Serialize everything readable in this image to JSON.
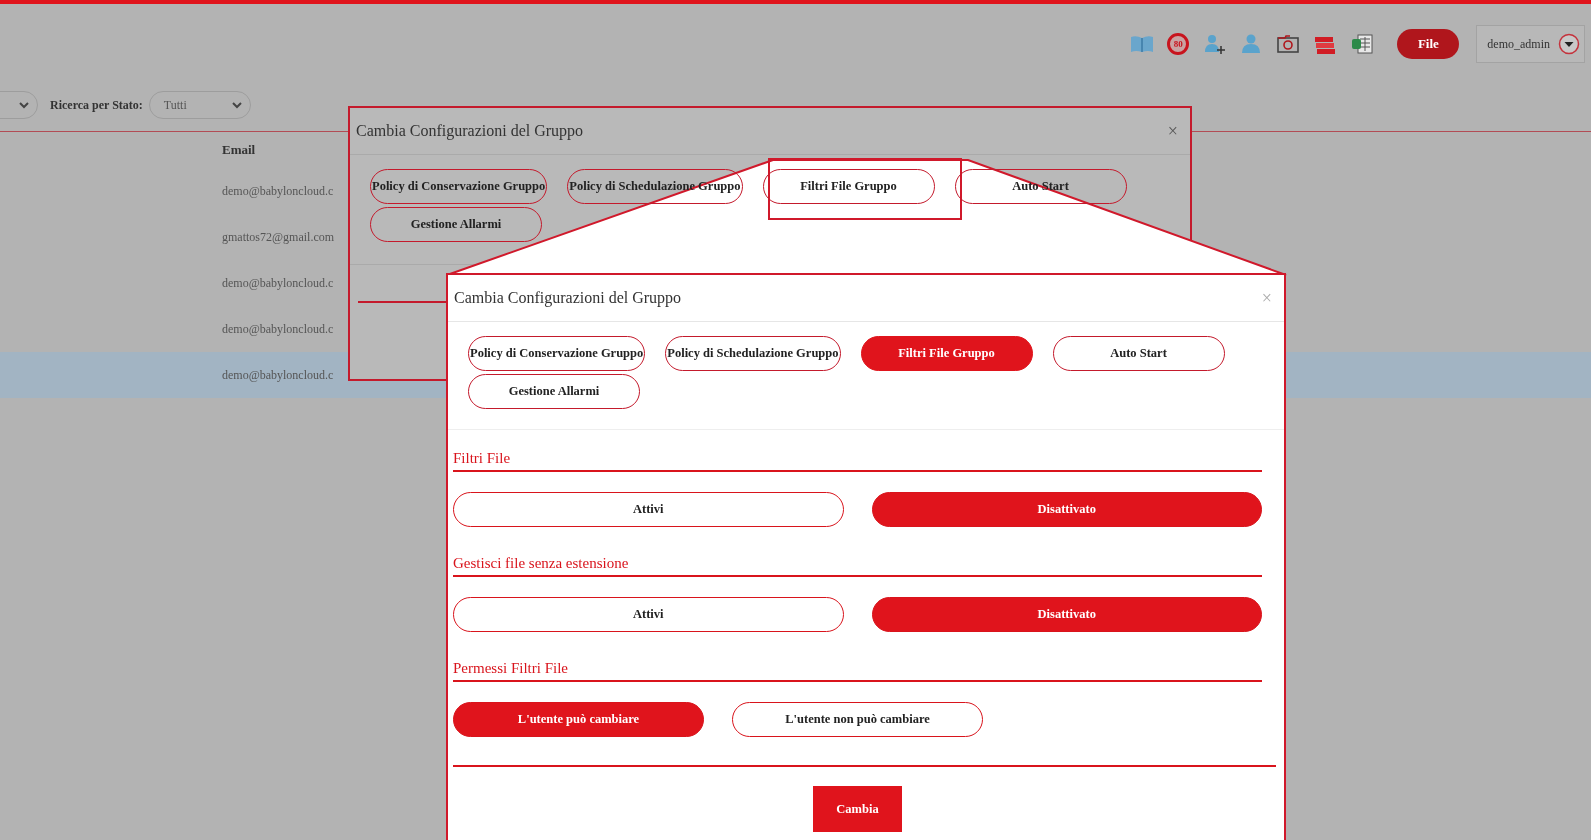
{
  "toolbar": {
    "badge_text": "80",
    "file_button": "File",
    "user_menu": "demo_admin"
  },
  "filters": {
    "status_label": "Ricerca per Stato:",
    "status_value": "Tutti"
  },
  "table": {
    "columns": [
      "Email"
    ],
    "rows": [
      {
        "email": "demo@babyloncloud.c",
        "selected": false
      },
      {
        "email": "gmattos72@gmail.com",
        "selected": false
      },
      {
        "email": "demo@babyloncloud.c",
        "selected": false
      },
      {
        "email": "demo@babyloncloud.c",
        "selected": false
      },
      {
        "email": "demo@babyloncloud.c",
        "selected": true
      }
    ]
  },
  "background_dialog": {
    "title": "Cambia Configurazioni del Gruppo",
    "close": "×",
    "tabs": [
      {
        "label": "Policy di Conservazione Gruppo",
        "selected": false
      },
      {
        "label": "Policy di Schedulazione Gruppo",
        "selected": false
      },
      {
        "label": "Filtri File Gruppo",
        "selected": false
      },
      {
        "label": "Auto Start",
        "selected": false
      },
      {
        "label": "Gestione Allarmi",
        "selected": false
      }
    ]
  },
  "zoomed_dialog": {
    "title": "Cambia Configurazioni del Gruppo",
    "close": "×",
    "tabs": [
      {
        "label": "Policy di Conservazione Gruppo",
        "selected": false
      },
      {
        "label": "Policy di Schedulazione Gruppo",
        "selected": false
      },
      {
        "label": "Filtri File Gruppo",
        "selected": true
      },
      {
        "label": "Auto Start",
        "selected": false
      },
      {
        "label": "Gestione Allarmi",
        "selected": false
      }
    ],
    "sections": [
      {
        "title": "Filtri File",
        "kind": "wide",
        "options": [
          {
            "label": "Attivi",
            "selected": false
          },
          {
            "label": "Disattivato",
            "selected": true
          }
        ]
      },
      {
        "title": "Gestisci file senza estensione",
        "kind": "wide",
        "options": [
          {
            "label": "Attivi",
            "selected": false
          },
          {
            "label": "Disattivato",
            "selected": true
          }
        ]
      },
      {
        "title": "Permessi Filtri File",
        "kind": "compact",
        "options": [
          {
            "label": "L'utente può cambiare",
            "selected": true
          },
          {
            "label": "L'utente non può cambiare",
            "selected": false
          }
        ]
      }
    ],
    "submit": "Cambia"
  }
}
